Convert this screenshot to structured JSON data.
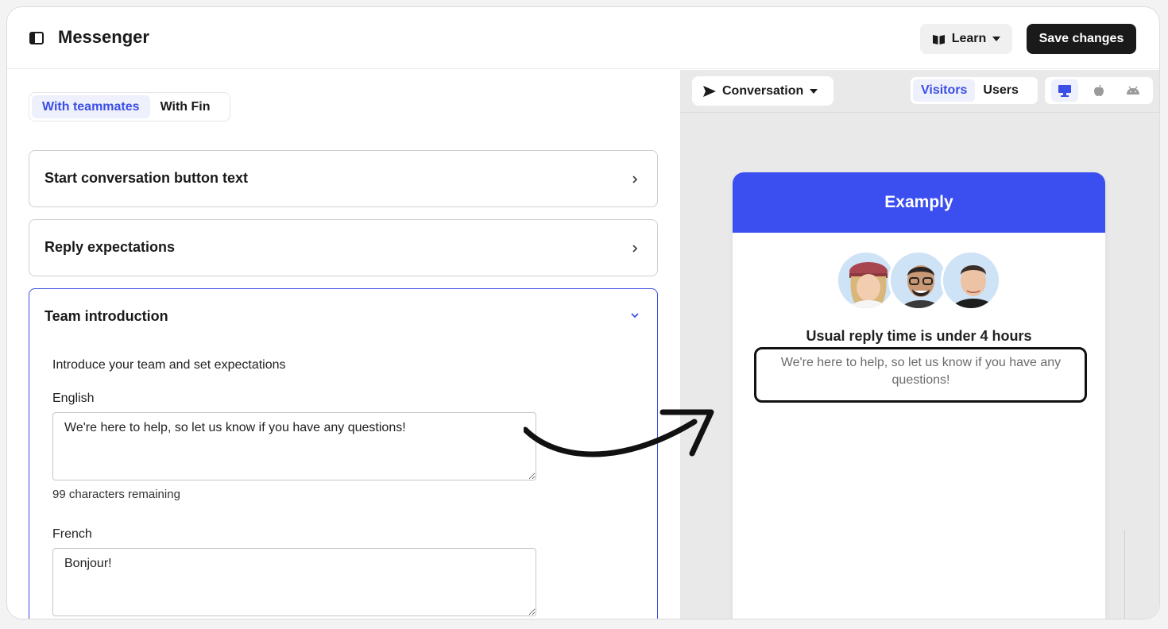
{
  "app": {
    "title": "Messenger",
    "learn_label": "Learn",
    "save_label": "Save changes"
  },
  "colors": {
    "accent": "#3b4ee6",
    "messenger_header": "#3b4ef0",
    "dark_button": "#1a1a1a"
  },
  "left": {
    "tabs": [
      {
        "label": "With teammates",
        "active": true
      },
      {
        "label": "With Fin",
        "active": false
      }
    ],
    "sections": [
      {
        "title": "Start conversation button text",
        "expanded": false
      },
      {
        "title": "Reply expectations",
        "expanded": false
      },
      {
        "title": "Team introduction",
        "expanded": true
      }
    ],
    "team_intro": {
      "description": "Introduce your team and set expectations",
      "languages": [
        {
          "label": "English",
          "value": "We're here to help, so let us know if you have any questions!",
          "remaining": "99 characters remaining"
        },
        {
          "label": "French",
          "value": "Bonjour!"
        }
      ]
    }
  },
  "right": {
    "preview_type": "Conversation",
    "audience_tabs": [
      {
        "label": "Visitors",
        "active": true
      },
      {
        "label": "Users",
        "active": false
      }
    ],
    "devices": [
      {
        "icon": "desktop-icon",
        "active": true
      },
      {
        "icon": "apple-icon",
        "active": false
      },
      {
        "icon": "android-icon",
        "active": false
      }
    ],
    "messenger": {
      "brand": "Examply",
      "reply_time": "Usual reply time is under 4 hours",
      "intro": "We're here to help, so let us know if you have any questions!"
    }
  }
}
